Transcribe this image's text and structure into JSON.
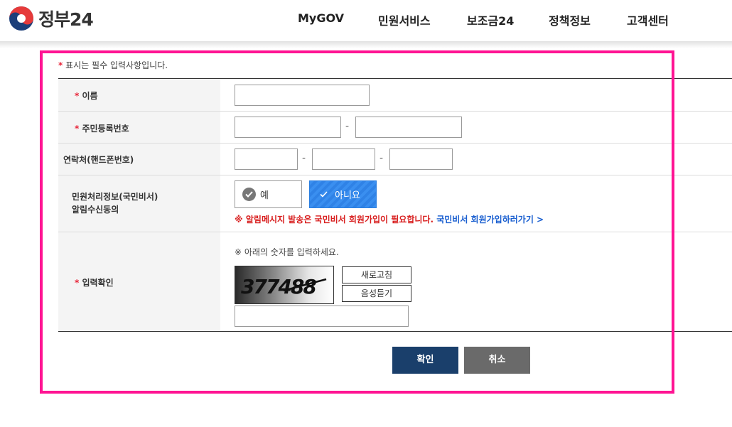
{
  "header": {
    "logo_text": "정부24",
    "nav": [
      "MyGOV",
      "민원서비스",
      "보조금24",
      "정책정보",
      "고객센터"
    ]
  },
  "form": {
    "required_mark": "*",
    "required_note": "표시는 필수 입력사항입니다.",
    "labels": {
      "name": "이름",
      "resident_number": "주민등록번호",
      "phone": "연락처(핸드폰번호)",
      "consent_line1": "민원처리정보(국민비서)",
      "consent_line2": "알림수신동의",
      "captcha": "입력확인"
    },
    "consent": {
      "yes_label": "예",
      "no_label": "아니요",
      "selected": "아니요",
      "notice_mark": "※",
      "notice_text": "알림메시지 발송은 국민비서 회원가입이 필요합니다.",
      "notice_link": "국민비서 회원가입하러가기 >"
    },
    "captcha": {
      "hint": "※ 아래의 숫자를 입력하세요.",
      "code": "377488",
      "refresh_label": "새로고침",
      "audio_label": "음성듣기"
    },
    "dash": "-"
  },
  "buttons": {
    "confirm": "확인",
    "cancel": "취소"
  },
  "colors": {
    "highlight_frame": "#ff1493",
    "required": "#e8263a",
    "selected_option": "#2f82e6",
    "confirm_button": "#1a3f6b",
    "cancel_button": "#6a6a6a"
  }
}
